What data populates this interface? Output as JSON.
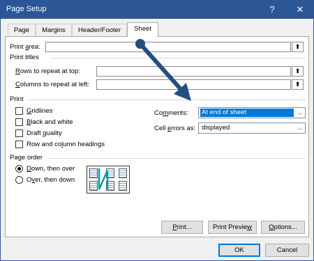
{
  "window": {
    "title": "Page Setup",
    "help_label": "?",
    "close_label": "✕"
  },
  "tabs": [
    {
      "label": "Page"
    },
    {
      "label": "Margins"
    },
    {
      "label": "Header/Footer"
    },
    {
      "label": "Sheet",
      "active": true
    }
  ],
  "sheet": {
    "print_area": {
      "label_pre": "Print ",
      "label_u": "a",
      "label_post": "rea:",
      "value": ""
    },
    "print_titles": {
      "title": "Print titles",
      "rows": {
        "label_u": "R",
        "label_post": "ows to repeat at top:",
        "value": ""
      },
      "columns": {
        "label_u": "C",
        "label_post": "olumns to repeat at left:",
        "value": ""
      }
    },
    "print_group": {
      "title": "Print",
      "gridlines": {
        "label_u": "G",
        "label_post": "ridlines",
        "checked": false
      },
      "black_white": {
        "label_u": "B",
        "label_post": "lack and white",
        "checked": false
      },
      "draft": {
        "label_pre": "Draft ",
        "label_u": "q",
        "label_post": "uality",
        "checked": false
      },
      "headings": {
        "label_pre": "Row and co",
        "label_u": "l",
        "label_post": "umn headings",
        "checked": false
      },
      "comments": {
        "label_pre": "Co",
        "label_u": "m",
        "label_post": "ments:",
        "value": "At end of sheet"
      },
      "cell_errors": {
        "label_pre": "Cell ",
        "label_u": "e",
        "label_post": "rrors as:",
        "value": "displayed"
      }
    },
    "page_order": {
      "title": "Page order",
      "down_then_over": {
        "label_u": "D",
        "label_post": "own, then over",
        "selected": true
      },
      "over_then_down": {
        "label_pre": "O",
        "label_u": "v",
        "label_post": "er, then down",
        "selected": false
      }
    }
  },
  "buttons": {
    "print": {
      "label_u": "P",
      "label_post": "rint..."
    },
    "print_preview": {
      "label_pre": "Print Previe",
      "label_u": "w",
      "label_post": ""
    },
    "options": {
      "label_u": "O",
      "label_post": "ptions..."
    },
    "ok": {
      "label": "OK"
    },
    "cancel": {
      "label": "Cancel"
    }
  },
  "colors": {
    "title_bar": "#2b5797",
    "highlight": "#0078d7",
    "annotation_arrow": "#234e80"
  },
  "icons": {
    "collapse": "collapse-dialog-icon",
    "dropdown": "chevron-down-icon",
    "annotation": "annotation-arrow"
  }
}
